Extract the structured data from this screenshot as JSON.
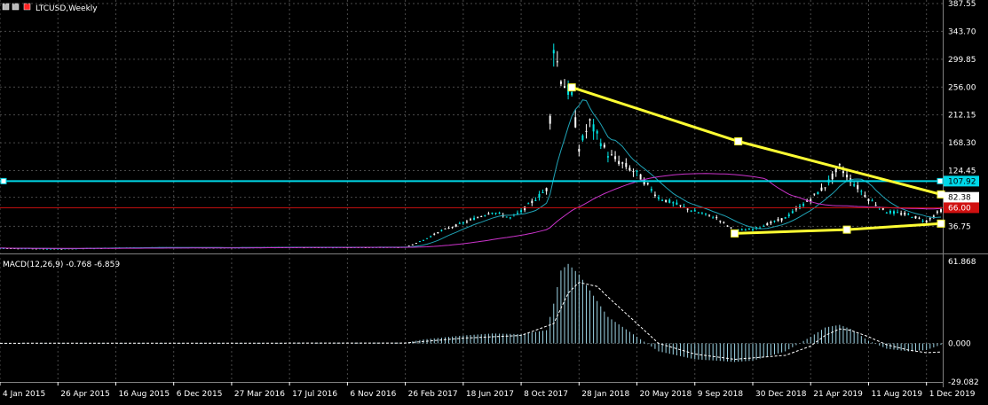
{
  "window": {
    "symbol_title": "LTCUSD,Weekly"
  },
  "colors": {
    "background": "#000000",
    "grid": "#4a4a4a",
    "axis_text": "#ffffff",
    "candle_up": "#00e5e5",
    "candle_down": "#ffffff",
    "ma_fast": "#1fa2b5",
    "ma_slow": "#cc33cc",
    "trendline": "#ffff33",
    "horizontal_cyan": "#00d8e8",
    "horizontal_red": "#d01010",
    "macd_hist": "#9fd7e8",
    "macd_signal": "#ffffff"
  },
  "chart_data": [
    {
      "type": "candlestick",
      "title": "LTCUSD,Weekly",
      "ylim": [
        -6,
        387.55
      ],
      "y_ticks": [
        "387.55",
        "343.70",
        "299.85",
        "256.00",
        "212.15",
        "168.30",
        "124.45",
        "82.38",
        "36.75"
      ],
      "x_ticks": [
        "4 Jan 2015",
        "26 Apr 2015",
        "16 Aug 2015",
        "6 Dec 2015",
        "27 Mar 2016",
        "17 Jul 2016",
        "6 Nov 2016",
        "26 Feb 2017",
        "18 Jun 2017",
        "8 Oct 2017",
        "28 Jan 2018",
        "20 May 2018",
        "9 Sep 2018",
        "30 Dec 2018",
        "21 Apr 2019",
        "11 Aug 2019",
        "1 Dec 2019"
      ],
      "price_tags": [
        {
          "label": "107.92",
          "value": 107.92,
          "color": "#00d8e8"
        },
        {
          "label": "82.38",
          "value": 82.38,
          "color": "#ffffff"
        },
        {
          "label": "66.00",
          "value": 66.0,
          "color": "#d01010"
        }
      ],
      "horizontal_lines": [
        {
          "value": 107.92,
          "color": "#00d8e8"
        },
        {
          "value": 66.0,
          "color": "#d01010"
        }
      ],
      "trendlines": [
        {
          "name": "upper",
          "points": [
            [
              "14 Jan 2018",
              255.5
            ],
            [
              "2 Dec 2018",
              170.5
            ],
            [
              "29 Dec 2019",
              87.0
            ]
          ]
        },
        {
          "name": "lower",
          "points": [
            [
              "25 Nov 2018",
              25.5
            ],
            [
              "30 Jun 2019",
              31.5
            ],
            [
              "29 Dec 2019",
              41.0
            ]
          ]
        }
      ],
      "series": [
        {
          "kind": "price",
          "points": [
            [
              "4 Jan 2015",
              2.5
            ],
            [
              "26 Apr 2015",
              1.5
            ],
            [
              "16 Aug 2015",
              3.0
            ],
            [
              "6 Dec 2015",
              3.5
            ],
            [
              "27 Mar 2016",
              3.2
            ],
            [
              "17 Jul 2016",
              3.9
            ],
            [
              "6 Nov 2016",
              3.8
            ],
            [
              "26 Feb 2017",
              4.0
            ],
            [
              "2 Apr 2017",
              15.0
            ],
            [
              "7 May 2017",
              30.0
            ],
            [
              "18 Jun 2017",
              42.0
            ],
            [
              "13 Aug 2017",
              60.0
            ],
            [
              "17 Sep 2017",
              50.0
            ],
            [
              "8 Oct 2017",
              60.0
            ],
            [
              "26 Nov 2017",
              95.0
            ],
            [
              "10 Dec 2017",
              320.0
            ],
            [
              "24 Dec 2017",
              270.0
            ],
            [
              "14 Jan 2018",
              240.0
            ],
            [
              "28 Jan 2018",
              160.0
            ],
            [
              "18 Feb 2018",
              200.0
            ],
            [
              "4 Mar 2018",
              180.0
            ],
            [
              "25 Mar 2018",
              150.0
            ],
            [
              "20 May 2018",
              120.0
            ],
            [
              "1 Jul 2018",
              82.0
            ],
            [
              "9 Sep 2018",
              60.0
            ],
            [
              "21 Oct 2018",
              50.0
            ],
            [
              "25 Nov 2018",
              30.0
            ],
            [
              "30 Dec 2018",
              32.0
            ],
            [
              "3 Mar 2019",
              50.0
            ],
            [
              "21 Apr 2019",
              80.0
            ],
            [
              "19 May 2019",
              100.0
            ],
            [
              "16 Jun 2019",
              130.0
            ],
            [
              "7 Jul 2019",
              110.0
            ],
            [
              "11 Aug 2019",
              80.0
            ],
            [
              "15 Sep 2019",
              60.0
            ],
            [
              "27 Oct 2019",
              55.0
            ],
            [
              "1 Dec 2019",
              45.0
            ],
            [
              "29 Dec 2019",
              62.0
            ]
          ]
        }
      ]
    },
    {
      "type": "bar",
      "title": "MACD(12,26,9) -0.768 -6.859",
      "ylim": [
        -29.082,
        61.868
      ],
      "y_ticks": [
        "61.868",
        "0.000",
        "-29.082"
      ],
      "series": [
        {
          "name": "MACD",
          "points": [
            [
              "4 Jan 2015",
              0.2
            ],
            [
              "26 Feb 2017",
              0.5
            ],
            [
              "2 Apr 2017",
              3.0
            ],
            [
              "18 Jun 2017",
              6.0
            ],
            [
              "13 Aug 2017",
              7.5
            ],
            [
              "8 Oct 2017",
              7.0
            ],
            [
              "26 Nov 2017",
              10.0
            ],
            [
              "10 Dec 2017",
              30.0
            ],
            [
              "24 Dec 2017",
              55.0
            ],
            [
              "7 Jan 2018",
              60.0
            ],
            [
              "28 Jan 2018",
              52.0
            ],
            [
              "18 Feb 2018",
              40.0
            ],
            [
              "25 Mar 2018",
              20.0
            ],
            [
              "20 May 2018",
              5.0
            ],
            [
              "1 Jul 2018",
              -6.0
            ],
            [
              "9 Sep 2018",
              -12.0
            ],
            [
              "21 Oct 2018",
              -13.0
            ],
            [
              "25 Nov 2018",
              -14.0
            ],
            [
              "30 Dec 2018",
              -13.0
            ],
            [
              "3 Mar 2019",
              -6.0
            ],
            [
              "21 Apr 2019",
              5.0
            ],
            [
              "19 May 2019",
              12.0
            ],
            [
              "16 Jun 2019",
              14.0
            ],
            [
              "7 Jul 2019",
              11.0
            ],
            [
              "11 Aug 2019",
              2.0
            ],
            [
              "15 Sep 2019",
              -4.0
            ],
            [
              "27 Oct 2019",
              -6.0
            ],
            [
              "1 Dec 2019",
              -5.0
            ],
            [
              "29 Dec 2019",
              -1.0
            ]
          ]
        },
        {
          "name": "Signal",
          "points": [
            [
              "4 Jan 2015",
              0.1
            ],
            [
              "26 Feb 2017",
              0.3
            ],
            [
              "18 Jun 2017",
              4.0
            ],
            [
              "8 Oct 2017",
              6.0
            ],
            [
              "10 Dec 2017",
              15.0
            ],
            [
              "7 Jan 2018",
              38.0
            ],
            [
              "28 Jan 2018",
              46.0
            ],
            [
              "4 Mar 2018",
              43.0
            ],
            [
              "25 Mar 2018",
              35.0
            ],
            [
              "20 May 2018",
              15.0
            ],
            [
              "1 Jul 2018",
              0.0
            ],
            [
              "9 Sep 2018",
              -8.0
            ],
            [
              "25 Nov 2018",
              -12.0
            ],
            [
              "3 Mar 2019",
              -9.0
            ],
            [
              "21 Apr 2019",
              -2.0
            ],
            [
              "19 May 2019",
              6.0
            ],
            [
              "16 Jun 2019",
              11.0
            ],
            [
              "7 Jul 2019",
              10.0
            ],
            [
              "11 Aug 2019",
              5.0
            ],
            [
              "15 Sep 2019",
              -1.0
            ],
            [
              "27 Oct 2019",
              -5.0
            ],
            [
              "1 Dec 2019",
              -7.0
            ],
            [
              "29 Dec 2019",
              -6.5
            ]
          ]
        }
      ]
    }
  ]
}
